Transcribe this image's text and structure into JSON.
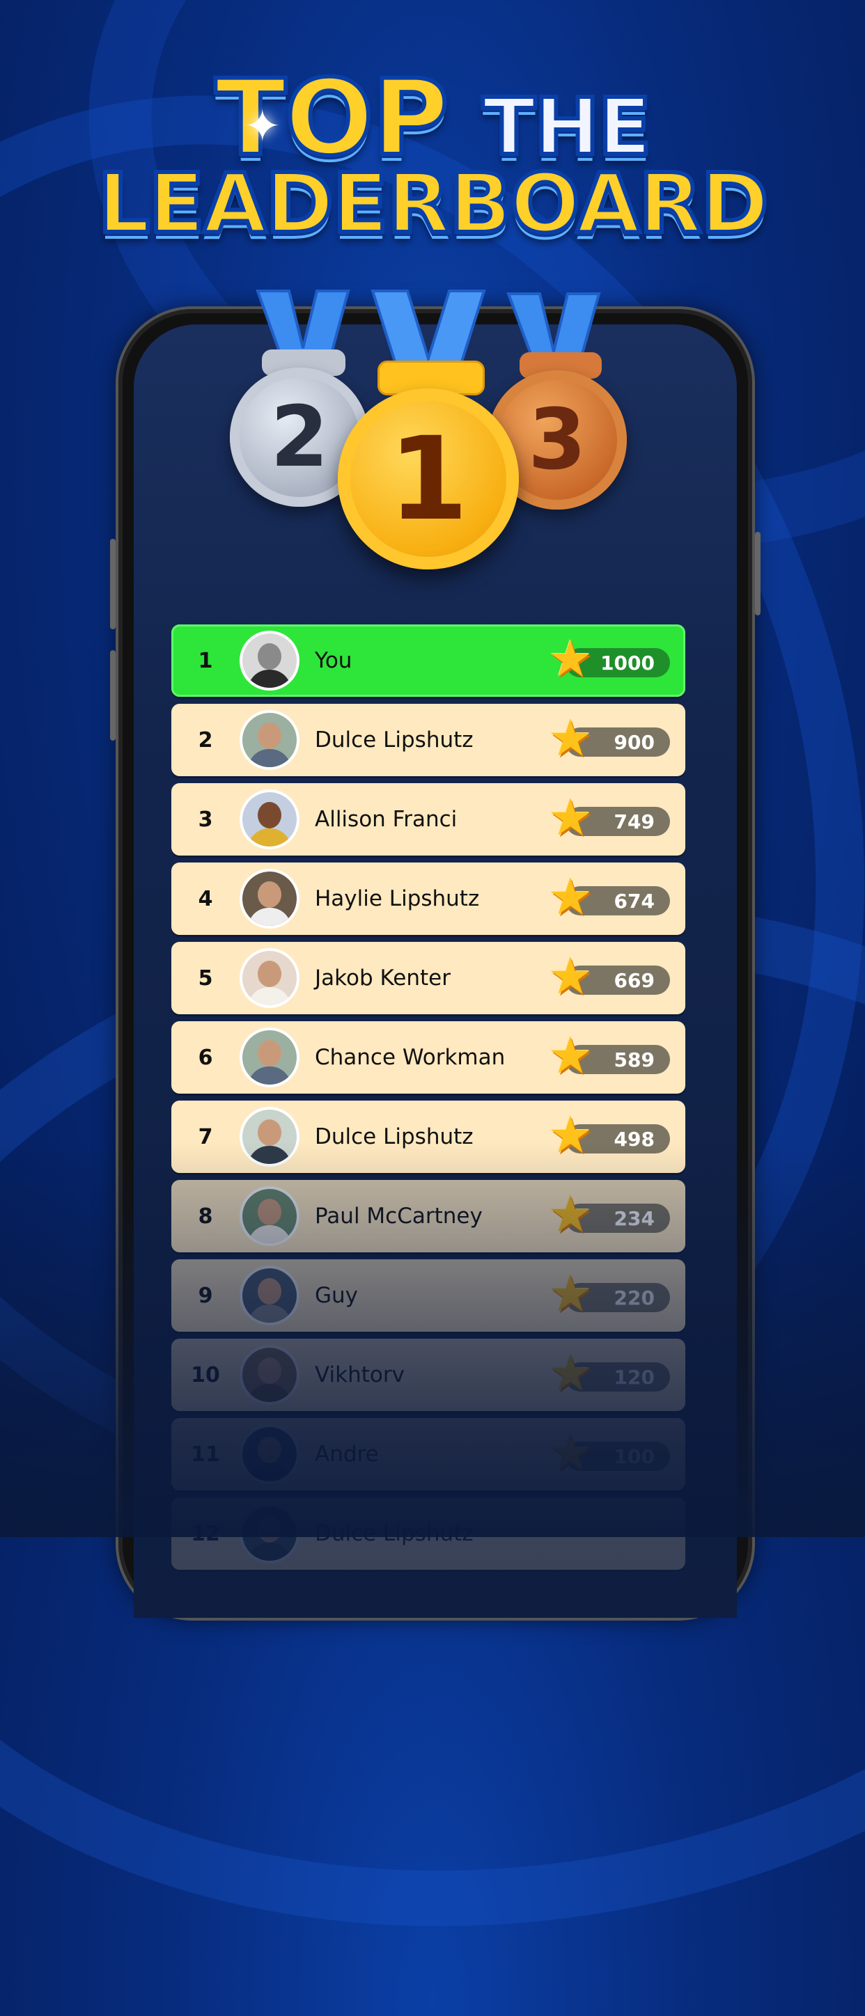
{
  "title": {
    "line1_top": "TOP",
    "line1_the": "THE",
    "line2": "LEADERBOARD"
  },
  "medals": {
    "gold": "1",
    "silver": "2",
    "bronze": "3"
  },
  "colors": {
    "background": "#072b7c",
    "title_yellow": "#ffd02a",
    "highlight_row": "#2ee53a",
    "row": "#ffe9c0",
    "score_pill": "#7c7563",
    "star": "#ffc21a"
  },
  "leaderboard": [
    {
      "rank": "1",
      "name": "You",
      "score": "1000",
      "highlight": true,
      "avatar": "avatar-icon"
    },
    {
      "rank": "2",
      "name": "Dulce Lipshutz",
      "score": "900",
      "avatar": "avatar-icon"
    },
    {
      "rank": "3",
      "name": "Allison Franci",
      "score": "749",
      "avatar": "avatar-icon"
    },
    {
      "rank": "4",
      "name": "Haylie Lipshutz",
      "score": "674",
      "avatar": "avatar-icon"
    },
    {
      "rank": "5",
      "name": "Jakob Kenter",
      "score": "669",
      "avatar": "avatar-icon"
    },
    {
      "rank": "6",
      "name": "Chance Workman",
      "score": "589",
      "avatar": "avatar-icon"
    },
    {
      "rank": "7",
      "name": "Dulce Lipshutz",
      "score": "498",
      "avatar": "avatar-icon"
    },
    {
      "rank": "8",
      "name": "Paul McCartney",
      "score": "234",
      "avatar": "avatar-icon"
    },
    {
      "rank": "9",
      "name": "Guy",
      "score": "220",
      "avatar": "avatar-icon"
    },
    {
      "rank": "10",
      "name": "Vikhtorv",
      "score": "120",
      "avatar": "avatar-icon"
    },
    {
      "rank": "11",
      "name": "Andre",
      "score": "100",
      "avatar": "avatar-icon"
    },
    {
      "rank": "12",
      "name": "Dulce Lipshutz",
      "score": "",
      "avatar": "avatar-icon"
    }
  ]
}
